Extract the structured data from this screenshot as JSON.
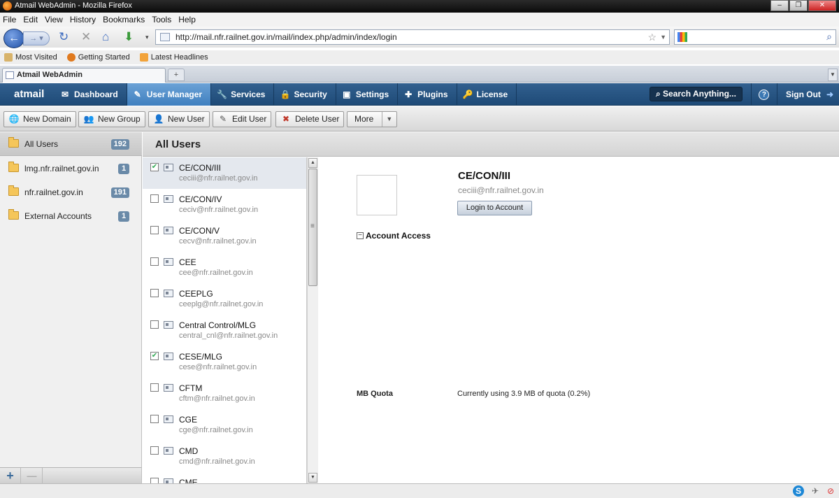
{
  "window": {
    "title": "Atmail WebAdmin - Mozilla Firefox",
    "buttons": [
      "–",
      "❐",
      "✕"
    ]
  },
  "menubar": [
    "File",
    "Edit",
    "View",
    "History",
    "Bookmarks",
    "Tools",
    "Help"
  ],
  "navbar": {
    "url": "http://mail.nfr.railnet.gov.in/mail/index.php/admin/index/login",
    "search_placeholder": ""
  },
  "bookmarks": [
    {
      "label": "Most Visited",
      "icon": "most-visited-icon",
      "color": "#d8b36a"
    },
    {
      "label": "Getting Started",
      "icon": "firefox-icon",
      "color": "#e07a1f"
    },
    {
      "label": "Latest Headlines",
      "icon": "rss-icon",
      "color": "#f2a33a"
    }
  ],
  "tab": {
    "label": "Atmail WebAdmin",
    "new_tab": "+"
  },
  "appnav": {
    "logo": "atmail",
    "items": [
      {
        "label": "Dashboard",
        "icon": "dashboard-icon",
        "glyph": "✉"
      },
      {
        "label": "User Manager",
        "icon": "user-manager-icon",
        "glyph": "✎",
        "active": true
      },
      {
        "label": "Services",
        "icon": "services-icon",
        "glyph": "🔧"
      },
      {
        "label": "Security",
        "icon": "security-icon",
        "glyph": "🔒"
      },
      {
        "label": "Settings",
        "icon": "settings-icon",
        "glyph": "▣"
      },
      {
        "label": "Plugins",
        "icon": "plugins-icon",
        "glyph": "✚"
      },
      {
        "label": "License",
        "icon": "license-icon",
        "glyph": "🔑"
      }
    ],
    "search": "Search Anything...",
    "help": "?",
    "signout": "Sign Out"
  },
  "toolbar": {
    "buttons": [
      {
        "label": "New Domain",
        "icon": "new-domain-icon",
        "glyph": "🌐",
        "color": "#2a7bd0"
      },
      {
        "label": "New Group",
        "icon": "new-group-icon",
        "glyph": "👥",
        "color": "#555"
      },
      {
        "label": "New User",
        "icon": "new-user-icon",
        "glyph": "👤",
        "color": "#3a8a3a"
      },
      {
        "label": "Edit User",
        "icon": "edit-user-icon",
        "glyph": "✎",
        "color": "#555"
      },
      {
        "label": "Delete User",
        "icon": "delete-user-icon",
        "glyph": "✖",
        "color": "#c0392b"
      }
    ],
    "more": "More",
    "more_arrow": "▼"
  },
  "folders": [
    {
      "label": "All Users",
      "count": "192",
      "selected": true
    },
    {
      "label": "lmg.nfr.railnet.gov.in",
      "count": "1"
    },
    {
      "label": "nfr.railnet.gov.in",
      "count": "191"
    },
    {
      "label": "External Accounts",
      "count": "1"
    }
  ],
  "folders_footer": {
    "add": "+",
    "remove": "—"
  },
  "list": {
    "title": "All Users",
    "users": [
      {
        "name": "CE/CON/III",
        "email": "ceciii@nfr.railnet.gov.in",
        "checked": true,
        "selected": true
      },
      {
        "name": "CE/CON/IV",
        "email": "ceciv@nfr.railnet.gov.in"
      },
      {
        "name": "CE/CON/V",
        "email": "cecv@nfr.railnet.gov.in"
      },
      {
        "name": "CEE",
        "email": "cee@nfr.railnet.gov.in"
      },
      {
        "name": "CEEPLG",
        "email": "ceeplg@nfr.railnet.gov.in"
      },
      {
        "name": "Central Control/MLG",
        "email": "central_cnl@nfr.railnet.gov.in"
      },
      {
        "name": "CESE/MLG",
        "email": "cese@nfr.railnet.gov.in",
        "checked": true
      },
      {
        "name": "CFTM",
        "email": "cftm@nfr.railnet.gov.in"
      },
      {
        "name": "CGE",
        "email": "cge@nfr.railnet.gov.in"
      },
      {
        "name": "CMD",
        "email": "cmd@nfr.railnet.gov.in"
      },
      {
        "name": "CME",
        "email": ""
      }
    ]
  },
  "detail": {
    "name": "CE/CON/III",
    "email": "ceciii@nfr.railnet.gov.in",
    "login_button": "Login to Account",
    "access_toggle": "−",
    "access_label": "Account Access",
    "quota_label": "MB Quota",
    "quota_value": "Currently using 3.9 MB of quota (0.2%)"
  },
  "statusbar": {
    "icons": [
      {
        "name": "skype-icon",
        "glyph": "S",
        "color": "#1e88d6"
      },
      {
        "name": "addon-icon",
        "glyph": "✈",
        "color": "#666"
      },
      {
        "name": "block-icon",
        "glyph": "⊘",
        "color": "#d33"
      }
    ]
  }
}
